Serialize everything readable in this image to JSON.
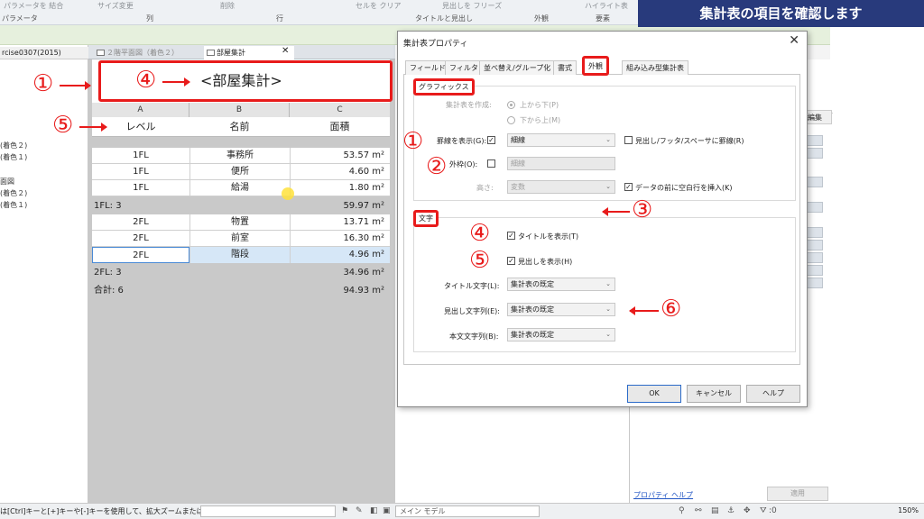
{
  "banner": {
    "text": "集計表の項目を確認します"
  },
  "ribbon": {
    "items": [
      "パラメータを 結合",
      "サイズ変更",
      "削除",
      "セルを クリア",
      "見出しを フリーズ",
      "ハイライト表"
    ],
    "captions": [
      "パラメータ",
      "列",
      "行",
      "タイトルと見出し",
      "外観",
      "要素"
    ]
  },
  "browser": {
    "title": "rcise0307(2015)",
    "items": [
      "(着色２)",
      "(着色１)",
      "面図",
      "(着色２)",
      "(着色１)"
    ]
  },
  "view_tabs": {
    "inactive": "２階平面図（着色２）",
    "active": "部屋集計",
    "close": "✕"
  },
  "schedule": {
    "title": "<部屋集計>",
    "letters": [
      "A",
      "B",
      "C"
    ],
    "headers": [
      "レベル",
      "名前",
      "面積"
    ],
    "rows": [
      {
        "level": "1FL",
        "name": "事務所",
        "area": "53.57 m²"
      },
      {
        "level": "1FL",
        "name": "便所",
        "area": "4.60 m²"
      },
      {
        "level": "1FL",
        "name": "給湯",
        "area": "1.80 m²"
      }
    ],
    "group1": {
      "label": "1FL: 3",
      "total": "59.97 m²"
    },
    "rows2": [
      {
        "level": "2FL",
        "name": "物置",
        "area": "13.71 m²"
      },
      {
        "level": "2FL",
        "name": "前室",
        "area": "16.30 m²"
      },
      {
        "level": "2FL",
        "name": "階段",
        "area": "4.96 m²"
      }
    ],
    "group2": {
      "label": "2FL: 3",
      "total": "34.96 m²"
    },
    "grand": {
      "label": "合計: 6",
      "total": "94.93 m²"
    }
  },
  "annotations": {
    "one": "①",
    "two": "②",
    "three": "③",
    "four": "④",
    "five": "⑤",
    "six": "⑥"
  },
  "dialog": {
    "title": "集計表プロパティ",
    "close": "✕",
    "tabs": [
      "フィールド",
      "フィルタ",
      "並べ替え/グループ化",
      "書式",
      "外観",
      "組み込み型集計表"
    ],
    "graphics_label": "グラフィックス",
    "build_label": "集計表を作成:",
    "radio_top": "上から下(P)",
    "radio_bottom": "下から上(M)",
    "gridlines_label": "罫線を表示(G):",
    "gridlines_value": "細線",
    "header_gridlines": "見出し/フッタ/スペーサに罫線(R)",
    "outline_label": "外枠(O):",
    "outline_value": "細線",
    "height_label": "高さ:",
    "height_value": "変数",
    "blank_row": "データの前に空白行を挿入(K)",
    "text_label": "文字",
    "show_title": "タイトルを表示(T)",
    "show_headers": "見出しを表示(H)",
    "title_text_label": "タイトル文字(L):",
    "title_text_value": "集計表の既定",
    "header_text_label": "見出し文字列(E):",
    "header_text_value": "集計表の既定",
    "body_text_label": "本文文字列(B):",
    "body_text_value": "集計表の既定",
    "ok": "OK",
    "cancel": "キャンセル",
    "help": "ヘルプ",
    "check": "✓",
    "chev": "⌄"
  },
  "properties": {
    "edit_label": "プ編集",
    "help_link": "プロパティ ヘルプ",
    "apply": "適用"
  },
  "status": {
    "hint": "は[Ctrl]キーと[+]キーや[-]キーを使用して、拡大ズームまたは",
    "model": "メイン モデル",
    "filter_count": ":0",
    "zoom": "150%"
  }
}
